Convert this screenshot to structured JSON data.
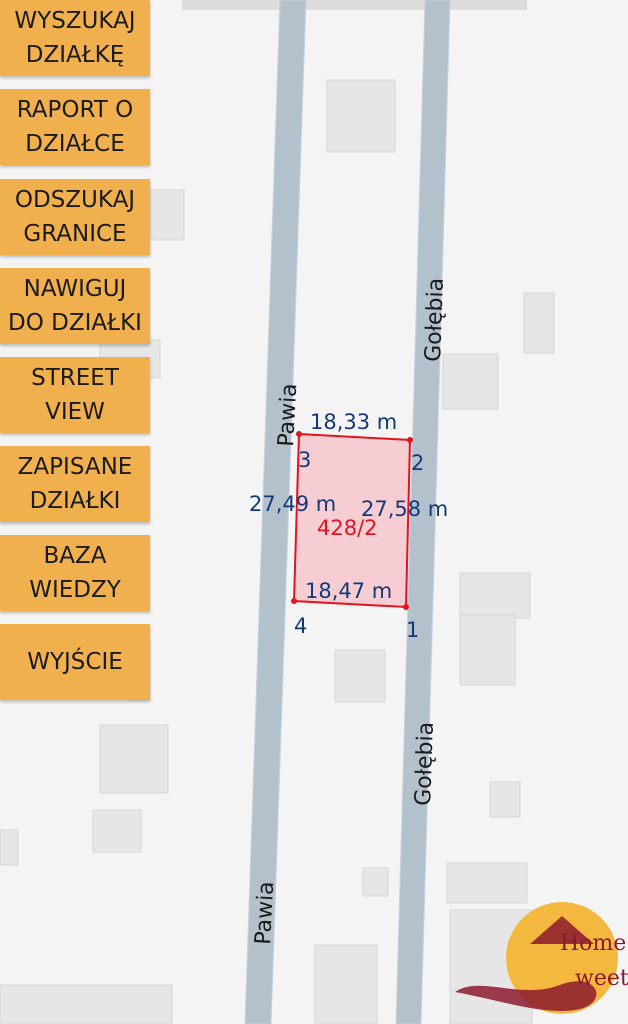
{
  "menu": {
    "items": [
      {
        "label": "WYSZUKAJ\nDZIAŁKĘ"
      },
      {
        "label": "RAPORT O\nDZIAŁCE"
      },
      {
        "label": "ODSZUKAJ\nGRANICE"
      },
      {
        "label": "NAWIGUJ\nDO DZIAŁKI"
      },
      {
        "label": "STREET\nVIEW"
      },
      {
        "label": "ZAPISANE\nDZIAŁKI"
      },
      {
        "label": "BAZA\nWIEDZY"
      },
      {
        "label": "WYJŚCIE"
      }
    ],
    "color": "#f0b04d"
  },
  "map": {
    "roads": {
      "left_name": "Pawia",
      "right_name": "Gołębia",
      "color": "#b3c1cd"
    },
    "parcel": {
      "id": "428/2",
      "fill": "#f6c6cb",
      "stroke": "#e0151f",
      "top_length": "18,33 m",
      "bottom_length": "18,47 m",
      "left_length": "27,49 m",
      "right_length": "27,58 m",
      "vertices": [
        "1",
        "2",
        "3",
        "4"
      ]
    }
  },
  "watermark": {
    "word1": "Home",
    "word2": "weet"
  }
}
